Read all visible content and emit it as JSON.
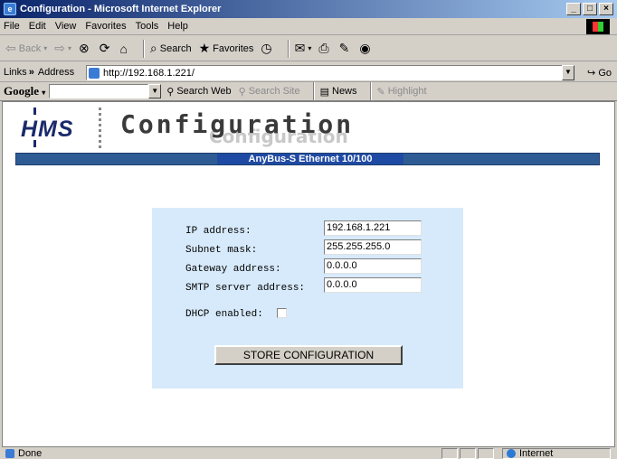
{
  "window": {
    "title": "Configuration - Microsoft Internet Explorer"
  },
  "menu": [
    "File",
    "Edit",
    "View",
    "Favorites",
    "Tools",
    "Help"
  ],
  "toolbar": {
    "back": "Back",
    "search": "Search",
    "favorites": "Favorites"
  },
  "address": {
    "links_label": "Links",
    "label": "Address",
    "url": "http://192.168.1.221/",
    "go": "Go"
  },
  "google": {
    "logo": "Google",
    "search_web": "Search Web",
    "search_site": "Search Site",
    "news": "News",
    "highlight": "Highlight"
  },
  "page": {
    "logo": "HMS",
    "title": "Configuration",
    "title_shadow": "Configuration",
    "banner": "AnyBus-S Ethernet 10/100"
  },
  "form": {
    "fields": [
      {
        "label": "IP address:",
        "value": "192.168.1.221"
      },
      {
        "label": "Subnet mask:",
        "value": "255.255.255.0"
      },
      {
        "label": "Gateway address:",
        "value": "0.0.0.0"
      },
      {
        "label": "SMTP server address:",
        "value": "0.0.0.0"
      }
    ],
    "dhcp_label": "DHCP enabled:",
    "dhcp_checked": false,
    "submit": "STORE CONFIGURATION"
  },
  "status": {
    "text": "Done",
    "zone": "Internet"
  }
}
